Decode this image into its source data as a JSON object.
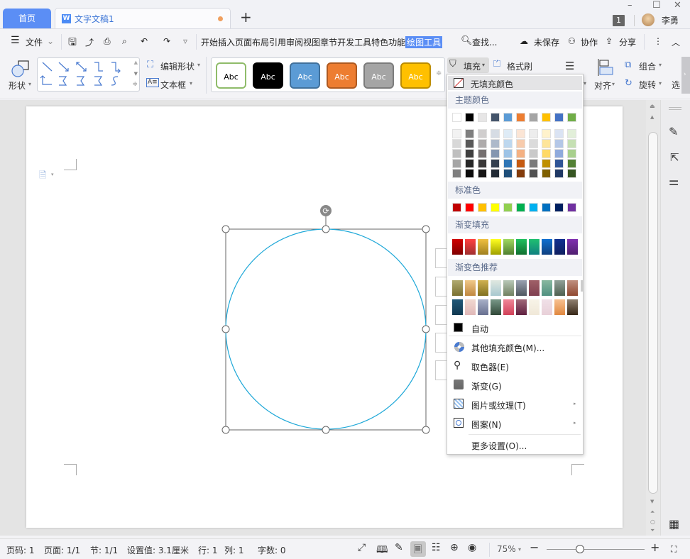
{
  "tabs": {
    "home": "首页",
    "doc": "文字文稿1",
    "add": "+"
  },
  "window": {
    "minimize": "–",
    "maximize": "☐",
    "close": "✕",
    "notification_count": "1",
    "user_name": "李勇"
  },
  "menu": {
    "file": "文件",
    "items": [
      "开始",
      "插入",
      "页面布局",
      "引用",
      "审阅",
      "视图",
      "章节",
      "开发工具",
      "特色功能",
      "绘图工具"
    ],
    "active": "绘图工具",
    "search": "查找...",
    "unsaved": "未保存",
    "collaborate": "协作",
    "share": "分享"
  },
  "ribbon": {
    "shape": "形状",
    "edit_shape": "编辑形状",
    "textbox": "文本框",
    "style_presets": [
      {
        "label": "Abc",
        "bg": "#ffffff",
        "border": "#8fbc6a",
        "fg": "#000000"
      },
      {
        "label": "Abc",
        "bg": "#000000",
        "border": "#000000",
        "fg": "#ffffff"
      },
      {
        "label": "Abc",
        "bg": "#5b9bd5",
        "border": "#41719c",
        "fg": "#ffffff"
      },
      {
        "label": "Abc",
        "bg": "#ed7d31",
        "border": "#ae5a21",
        "fg": "#ffffff"
      },
      {
        "label": "Abc",
        "bg": "#a5a5a5",
        "border": "#7c7c7c",
        "fg": "#ffffff"
      },
      {
        "label": "Abc",
        "bg": "#ffc000",
        "border": "#bc8c00",
        "fg": "#ffffff"
      }
    ],
    "fill": "填充",
    "format_painter": "格式刷",
    "group": "组合",
    "align": "对齐",
    "rotate": "旋转",
    "select": "选"
  },
  "fill_menu": {
    "no_fill": "无填充颜色",
    "theme_colors_title": "主题颜色",
    "theme_colors": [
      "#ffffff",
      "#000000",
      "#e7e6e6",
      "#44546a",
      "#5b9bd5",
      "#ed7d31",
      "#a5a5a5",
      "#ffc000",
      "#4472c4",
      "#70ad47"
    ],
    "theme_shades": [
      [
        "#f2f2f2",
        "#d8d8d8",
        "#bfbfbf",
        "#a5a5a5",
        "#7f7f7f"
      ],
      [
        "#7f7f7f",
        "#595959",
        "#3f3f3f",
        "#262626",
        "#0c0c0c"
      ],
      [
        "#d0cece",
        "#aeabab",
        "#757070",
        "#3a3838",
        "#171616"
      ],
      [
        "#d6dce4",
        "#adb9ca",
        "#8496b0",
        "#333f4f",
        "#222a35"
      ],
      [
        "#deebf6",
        "#bdd7ee",
        "#9dc3e6",
        "#2e75b5",
        "#1e4e79"
      ],
      [
        "#fbe5d5",
        "#f7cbac",
        "#f4b183",
        "#c55a11",
        "#833c0b"
      ],
      [
        "#ededed",
        "#dbdbdb",
        "#c9c9c9",
        "#7b7b7b",
        "#525252"
      ],
      [
        "#fff2cc",
        "#fee599",
        "#ffd965",
        "#bf9000",
        "#7f6000"
      ],
      [
        "#dae3f3",
        "#b4c7e7",
        "#8faadc",
        "#2f5496",
        "#1f3864"
      ],
      [
        "#e2efd9",
        "#c5e0b3",
        "#a8d08d",
        "#538135",
        "#375623"
      ]
    ],
    "standard_title": "标准色",
    "standard_colors": [
      "#c00000",
      "#ff0000",
      "#ffc000",
      "#ffff00",
      "#92d050",
      "#00b050",
      "#00b0f0",
      "#0070c0",
      "#002060",
      "#7030a0"
    ],
    "gradient_title": "渐变填充",
    "gradient_colors": [
      [
        "#d00000",
        "#800000"
      ],
      [
        "#ff4040",
        "#a03030"
      ],
      [
        "#f0c040",
        "#a08020"
      ],
      [
        "#ffff20",
        "#a0a000"
      ],
      [
        "#a0d860",
        "#508030"
      ],
      [
        "#20c060",
        "#107030"
      ],
      [
        "#20c070",
        "#108080"
      ],
      [
        "#1070d0",
        "#104080"
      ],
      [
        "#103090",
        "#102060"
      ],
      [
        "#8030b0",
        "#502070"
      ]
    ],
    "recommended_title": "渐变色推荐",
    "recommended_row1": [
      [
        "#b0aa70",
        "#7a7030"
      ],
      [
        "#f0c888",
        "#c08840"
      ],
      [
        "#d0b050",
        "#807020"
      ],
      [
        "#e0e8e0",
        "#a8c8d0"
      ],
      [
        "#b8c8b8",
        "#708060"
      ],
      [
        "#98a0b0",
        "#505860"
      ],
      [
        "#a06068",
        "#804050"
      ],
      [
        "#88b8a0",
        "#509080"
      ],
      [
        "#90a098",
        "#506050"
      ],
      [
        "#c09080",
        "#904830"
      ]
    ],
    "recommended_row2": [
      [
        "#205878",
        "#103850"
      ],
      [
        "#f0d8d0",
        "#e0b8b8"
      ],
      [
        "#a8b0c8",
        "#687090"
      ],
      [
        "#789888",
        "#304838"
      ],
      [
        "#f08898",
        "#d04058"
      ],
      [
        "#a06878",
        "#602040"
      ],
      [
        "#f8f4e8",
        "#f0e8d8"
      ],
      [
        "#f0e0e8",
        "#e8d0d8"
      ],
      [
        "#f8c090",
        "#e08840"
      ],
      [
        "#908070",
        "#382818"
      ]
    ],
    "auto": "自动",
    "auto_color": "#000000",
    "more_colors": "其他填充颜色(M)...",
    "eyedropper": "取色器(E)",
    "gradient": "渐变(G)",
    "picture_texture": "图片或纹理(T)",
    "pattern": "图案(N)",
    "more_settings": "更多设置(O)..."
  },
  "status": {
    "page_no": "页码: 1",
    "pages": "页面: 1/1",
    "section": "节: 1/1",
    "setting": "设置值: 3.1厘米",
    "row": "行: 1",
    "col": "列: 1",
    "words": "字数: 0",
    "zoom": "75%",
    "zoom_percent": 75
  },
  "shape": {
    "stroke": "#1fa8d8"
  }
}
